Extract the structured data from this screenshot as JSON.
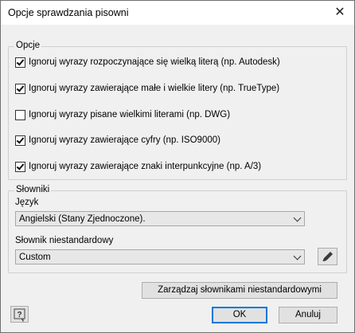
{
  "window": {
    "title": "Opcje sprawdzania pisowni",
    "close_glyph": "✕"
  },
  "options_group": {
    "legend": "Opcje",
    "items": [
      {
        "label": "Ignoruj wyrazy rozpoczynające się wielką literą (np. Autodesk)",
        "checked": true
      },
      {
        "label": "Ignoruj wyrazy zawierające małe i wielkie litery (np. TrueType)",
        "checked": true
      },
      {
        "label": "Ignoruj wyrazy pisane wielkimi literami (np. DWG)",
        "checked": false
      },
      {
        "label": "Ignoruj wyrazy zawierające cyfry (np. ISO9000)",
        "checked": true
      },
      {
        "label": "Ignoruj wyrazy zawierające znaki interpunkcyjne (np. A/3)",
        "checked": true
      }
    ]
  },
  "dictionaries_group": {
    "legend": "Słowniki",
    "language_label": "Język",
    "language_value": "Angielski (Stany Zjednoczone).",
    "custom_label": "Słownik niestandardowy",
    "custom_value": "Custom"
  },
  "buttons": {
    "manage": "Zarządzaj słownikami niestandardowymi",
    "ok": "OK",
    "cancel": "Anuluj",
    "help_glyph": "?"
  }
}
